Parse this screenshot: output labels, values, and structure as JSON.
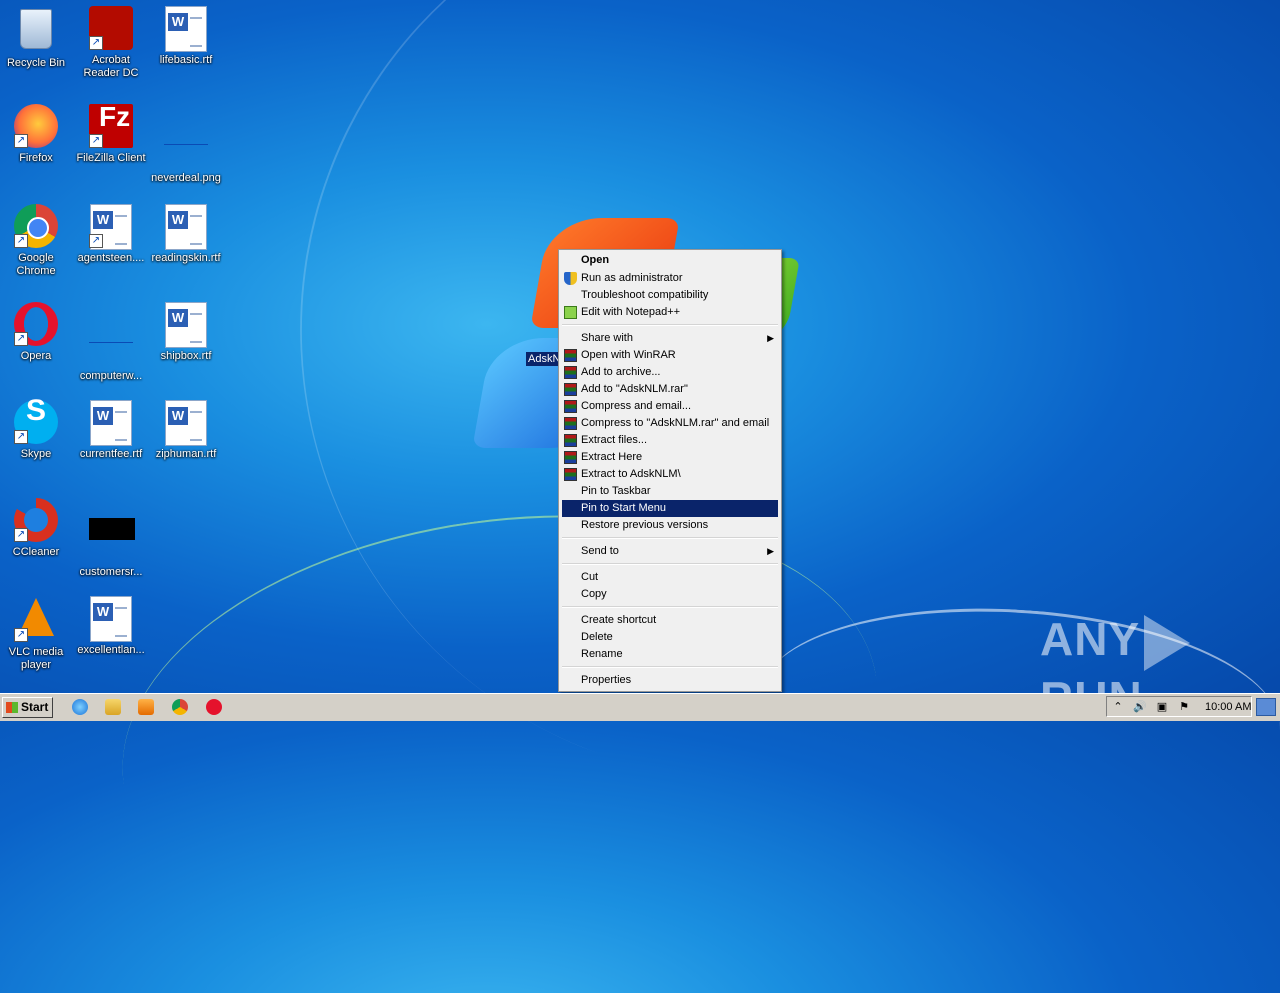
{
  "desktop_icons": [
    {
      "name": "recycle-bin-icon",
      "label": "Recycle Bin",
      "kind": "bin"
    },
    {
      "name": "acrobat-icon",
      "label": "Acrobat Reader DC",
      "kind": "app",
      "color": "#b30b00"
    },
    {
      "name": "lifebasic-icon",
      "label": "lifebasic.rtf",
      "kind": "doc"
    },
    {
      "name": "firefox-icon",
      "label": "Firefox",
      "kind": "app",
      "color": "#ff7139"
    },
    {
      "name": "filezilla-icon",
      "label": "FileZilla Client",
      "kind": "app",
      "color": "#bf0000"
    },
    {
      "name": "neverdeal-icon",
      "label": "neverdeal.png",
      "kind": "blank"
    },
    {
      "name": "chrome-icon",
      "label": "Google Chrome",
      "kind": "app",
      "color": "#4285f4"
    },
    {
      "name": "agentsteen-icon",
      "label": "agentsteen....",
      "kind": "doc"
    },
    {
      "name": "readingskin-icon",
      "label": "readingskin.rtf",
      "kind": "doc"
    },
    {
      "name": "opera-icon",
      "label": "Opera",
      "kind": "app",
      "color": "#e5122c"
    },
    {
      "name": "computerw-icon",
      "label": "computerw...",
      "kind": "blank"
    },
    {
      "name": "shipbox-icon",
      "label": "shipbox.rtf",
      "kind": "doc"
    },
    {
      "name": "skype-icon",
      "label": "Skype",
      "kind": "app",
      "color": "#00aff0"
    },
    {
      "name": "currentfee-icon",
      "label": "currentfee.rtf",
      "kind": "doc"
    },
    {
      "name": "ziphuman-icon",
      "label": "ziphuman.rtf",
      "kind": "doc"
    },
    {
      "name": "ccleaner-icon",
      "label": "CCleaner",
      "kind": "app",
      "color": "#d8301f"
    },
    {
      "name": "customersr-icon",
      "label": "customersr...",
      "kind": "black"
    },
    {
      "name": "vlc-icon",
      "label": "VLC media player",
      "kind": "app",
      "color": "#f28a00"
    },
    {
      "name": "excellentlan-icon",
      "label": "excellentlan...",
      "kind": "doc"
    }
  ],
  "selected_file_label": "AdskN",
  "context_menu": {
    "open": "Open",
    "run_admin": "Run as administrator",
    "troubleshoot": "Troubleshoot compatibility",
    "notepadpp": "Edit with Notepad++",
    "share_with": "Share with",
    "open_winrar": "Open with WinRAR",
    "add_archive": "Add to archive...",
    "add_rar": "Add to \"AdskNLM.rar\"",
    "compress_email": "Compress and email...",
    "compress_rar_email": "Compress to \"AdskNLM.rar\" and email",
    "extract_files": "Extract files...",
    "extract_here": "Extract Here",
    "extract_to": "Extract to AdskNLM\\",
    "pin_taskbar": "Pin to Taskbar",
    "pin_start": "Pin to Start Menu",
    "restore": "Restore previous versions",
    "send_to": "Send to",
    "cut": "Cut",
    "copy": "Copy",
    "create_shortcut": "Create shortcut",
    "delete": "Delete",
    "rename": "Rename",
    "properties": "Properties"
  },
  "taskbar": {
    "start_label": "Start",
    "clock": "10:00 AM",
    "pinned": [
      "ie-icon",
      "explorer-icon",
      "media-player-icon",
      "chrome-taskbar-icon",
      "opera-taskbar-icon"
    ]
  },
  "watermark": {
    "left": "ANY",
    "right": "RUN"
  },
  "colors": {
    "menu_highlight": "#0a246a",
    "taskbar": "#d4d0c8"
  }
}
